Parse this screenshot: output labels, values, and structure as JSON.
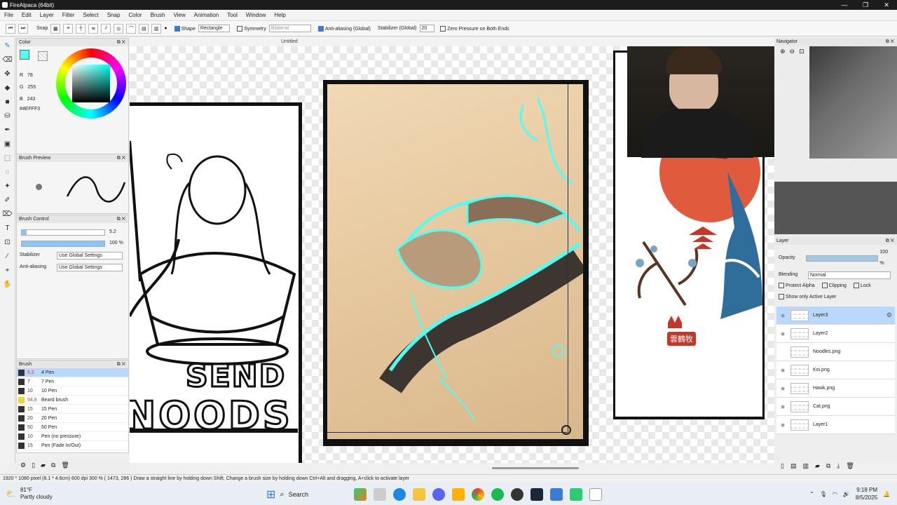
{
  "window": {
    "title": "FireAlpaca (64bit)",
    "controls": [
      "—",
      "❐",
      "✕"
    ]
  },
  "menu": [
    "File",
    "Edit",
    "Layer",
    "Filter",
    "Select",
    "Snap",
    "Color",
    "Brush",
    "View",
    "Animation",
    "Tool",
    "Window",
    "Help"
  ],
  "toolbar": {
    "snap_label": "Snap",
    "shape_label": "Shape",
    "shape_value": "Rectangle",
    "symmetry_label": "Symmetry",
    "symmetry_value": "Bilateral",
    "antialias_label": "Anti-aliasing (Global)",
    "stabilizer_label": "Stabilizer (Global)",
    "stabilizer_value": "20",
    "zero_pressure_label": "Zero Pressure on Both Ends"
  },
  "document": {
    "tab_title": "Untitled"
  },
  "color_panel": {
    "title": "Color",
    "r_label": "R",
    "r_value": "78",
    "g_label": "G",
    "g_value": "255",
    "b_label": "B",
    "b_value": "243",
    "hex": "#4EFFF3",
    "accent": "#4EFFF3"
  },
  "brush_preview": {
    "title": "Brush Preview"
  },
  "brush_control": {
    "title": "Brush Control",
    "size_value": "5.2",
    "size_fill": 0.06,
    "opacity_value": "100 %",
    "opacity_fill": 1.0,
    "stabilizer_label": "Stabilizer",
    "stabilizer_value": "Use Global Settings",
    "antialias_label": "Anti-aliasing",
    "antialias_value": "Use Global Settings"
  },
  "brush_panel": {
    "title": "Brush",
    "items": [
      {
        "size": "5.2",
        "name": "4 Pen",
        "active": true
      },
      {
        "size": "7",
        "name": "7 Pen"
      },
      {
        "size": "10",
        "name": "10 Pen"
      },
      {
        "size": "94.8",
        "name": "Beard brush"
      },
      {
        "size": "15",
        "name": "15 Pen"
      },
      {
        "size": "20",
        "name": "20 Pen"
      },
      {
        "size": "50",
        "name": "50 Pen"
      },
      {
        "size": "10",
        "name": "Pen (no pressure)"
      },
      {
        "size": "15",
        "name": "Pen (Fade In/Out)"
      }
    ]
  },
  "canvas_text": {
    "sign_line1": "SEND",
    "sign_line2": "NOODS",
    "stamp": "雲鶴牧"
  },
  "navigator": {
    "title": "Navigator"
  },
  "layer_panel": {
    "title": "Layer",
    "opacity_label": "Opacity",
    "opacity_value": "100 %",
    "blending_label": "Blending",
    "blending_value": "Normal",
    "protect_alpha_label": "Protect Alpha",
    "clipping_label": "Clipping",
    "lock_label": "Lock",
    "show_only_active_label": "Show only Active Layer",
    "layers": [
      {
        "name": "Layer3",
        "active": true
      },
      {
        "name": "Layer2"
      },
      {
        "name": "Noodles.png"
      },
      {
        "name": "Koi.png"
      },
      {
        "name": "Hawk.png"
      },
      {
        "name": "Cat.png"
      },
      {
        "name": "Layer1"
      }
    ]
  },
  "status": {
    "text": "1920 * 1080 pixel   (8.1 * 4.6cm)   600 dpi   300 %   ( 1473, 286 )   Draw a straight line by holding down Shift, Change a brush size by holding down Ctrl+Alt and dragging, A+click to activate layer"
  },
  "taskbar": {
    "weather_temp": "81°F",
    "weather_desc": "Partly cloudy",
    "search_label": "Search",
    "time": "9:18 PM",
    "date": "8/5/2025"
  }
}
